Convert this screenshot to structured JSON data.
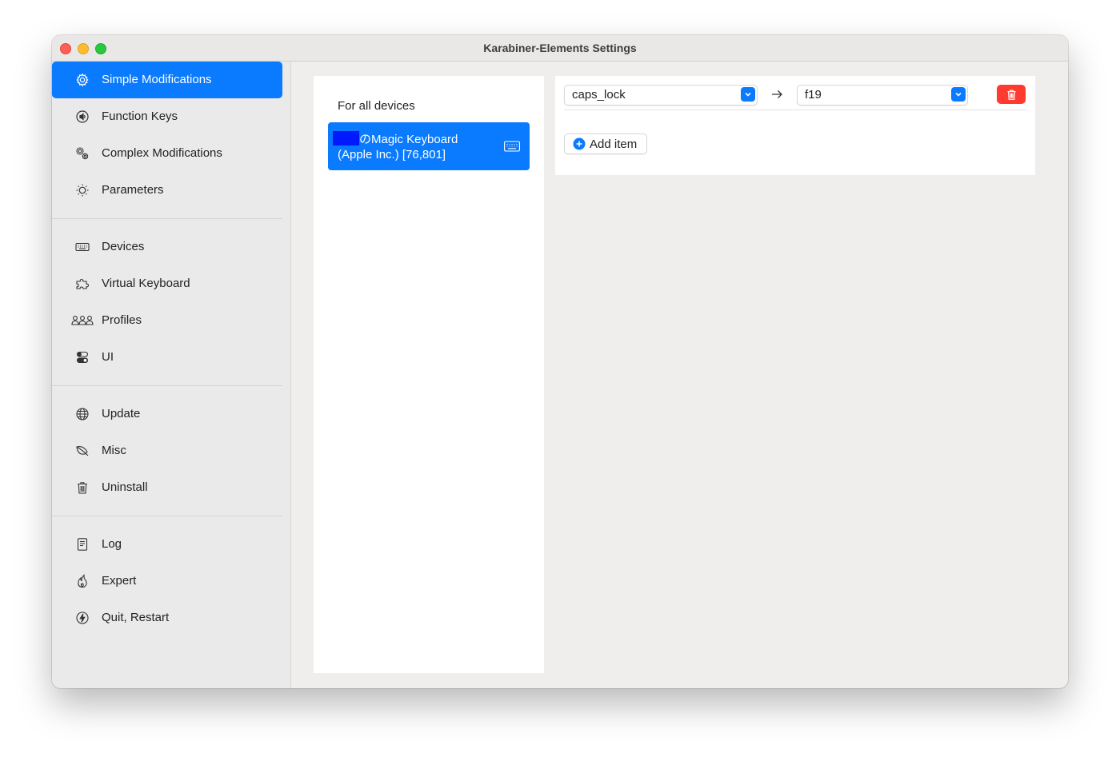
{
  "window": {
    "title": "Karabiner-Elements Settings"
  },
  "sidebar": {
    "items": [
      {
        "label": "Simple Modifications",
        "icon": "gear-icon",
        "selected": true
      },
      {
        "label": "Function Keys",
        "icon": "speaker-icon"
      },
      {
        "label": "Complex Modifications",
        "icon": "gears-icon"
      },
      {
        "label": "Parameters",
        "icon": "sun-icon"
      },
      {
        "label": "Devices",
        "icon": "keyboard-icon"
      },
      {
        "label": "Virtual Keyboard",
        "icon": "puzzle-icon"
      },
      {
        "label": "Profiles",
        "icon": "people-icon"
      },
      {
        "label": "UI",
        "icon": "toggles-icon"
      },
      {
        "label": "Update",
        "icon": "globe-icon"
      },
      {
        "label": "Misc",
        "icon": "leaf-icon"
      },
      {
        "label": "Uninstall",
        "icon": "trash-icon"
      },
      {
        "label": "Log",
        "icon": "document-icon"
      },
      {
        "label": "Expert",
        "icon": "flame-icon"
      },
      {
        "label": "Quit, Restart",
        "icon": "bolt-icon"
      }
    ]
  },
  "devices": {
    "all_label": "For all devices",
    "selected_line1": "のMagic Keyboard",
    "selected_line2": "(Apple Inc.) [76,801]"
  },
  "rules": {
    "from_value": "caps_lock",
    "to_value": "f19",
    "add_label": "Add item"
  },
  "colors": {
    "accent": "#0a7aff",
    "delete": "#ff3b30",
    "redaction": "#0019ff"
  }
}
